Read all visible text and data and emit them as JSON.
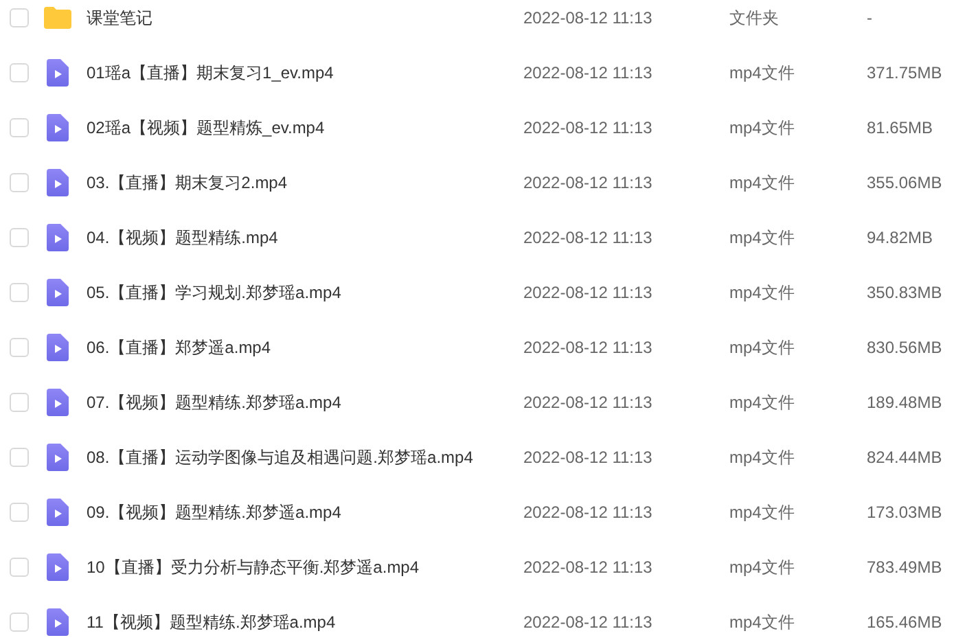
{
  "files": [
    {
      "kind": "folder",
      "checked": false,
      "name": "课堂笔记",
      "modified": "2022-08-12 11:13",
      "type": "文件夹",
      "size": "-"
    },
    {
      "kind": "video",
      "checked": false,
      "name": "01瑶a【直播】期末复习1_ev.mp4",
      "modified": "2022-08-12 11:13",
      "type": "mp4文件",
      "size": "371.75MB"
    },
    {
      "kind": "video",
      "checked": false,
      "name": "02瑶a【视频】题型精炼_ev.mp4",
      "modified": "2022-08-12 11:13",
      "type": "mp4文件",
      "size": "81.65MB"
    },
    {
      "kind": "video",
      "checked": false,
      "name": "03.【直播】期末复习2.mp4",
      "modified": "2022-08-12 11:13",
      "type": "mp4文件",
      "size": "355.06MB"
    },
    {
      "kind": "video",
      "checked": false,
      "name": "04.【视频】题型精练.mp4",
      "modified": "2022-08-12 11:13",
      "type": "mp4文件",
      "size": "94.82MB"
    },
    {
      "kind": "video",
      "checked": false,
      "name": "05.【直播】学习规划.郑梦瑶a.mp4",
      "modified": "2022-08-12 11:13",
      "type": "mp4文件",
      "size": "350.83MB"
    },
    {
      "kind": "video",
      "checked": false,
      "name": "06.【直播】郑梦遥a.mp4",
      "modified": "2022-08-12 11:13",
      "type": "mp4文件",
      "size": "830.56MB"
    },
    {
      "kind": "video",
      "checked": false,
      "name": "07.【视频】题型精练.郑梦瑶a.mp4",
      "modified": "2022-08-12 11:13",
      "type": "mp4文件",
      "size": "189.48MB"
    },
    {
      "kind": "video",
      "checked": false,
      "name": "08.【直播】运动学图像与追及相遇问题.郑梦瑶a.mp4",
      "modified": "2022-08-12 11:13",
      "type": "mp4文件",
      "size": "824.44MB"
    },
    {
      "kind": "video",
      "checked": false,
      "name": "09.【视频】题型精练.郑梦遥a.mp4",
      "modified": "2022-08-12 11:13",
      "type": "mp4文件",
      "size": "173.03MB"
    },
    {
      "kind": "video",
      "checked": false,
      "name": "10【直播】受力分析与静态平衡.郑梦遥a.mp4",
      "modified": "2022-08-12 11:13",
      "type": "mp4文件",
      "size": "783.49MB"
    },
    {
      "kind": "video",
      "checked": false,
      "name": "11【视频】题型精练.郑梦瑶a.mp4",
      "modified": "2022-08-12 11:13",
      "type": "mp4文件",
      "size": "165.46MB"
    }
  ]
}
